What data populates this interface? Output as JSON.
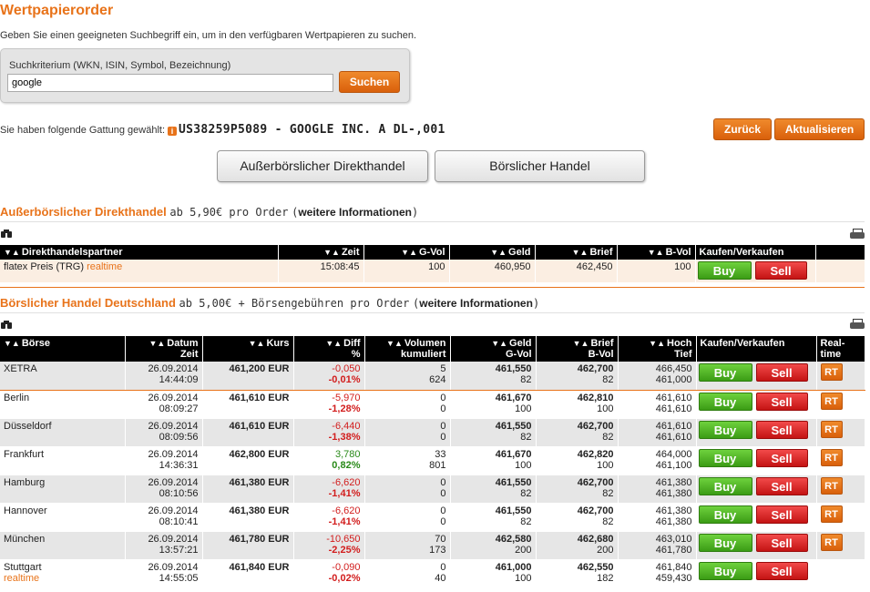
{
  "header": {
    "title": "Wertpapierorder",
    "intro": "Geben Sie einen geeigneten Suchbegriff ein, um in den verfügbaren Wertpapieren zu suchen."
  },
  "search": {
    "label": "Suchkriterium (WKN, ISIN, Symbol, Bezeichnung)",
    "value": "google",
    "button": "Suchen"
  },
  "selection": {
    "prefix": "Sie haben folgende Gattung gewählt:",
    "security": "US38259P5089 - GOOGLE INC. A DL-,001",
    "back": "Zurück",
    "refresh": "Aktualisieren"
  },
  "tabs": [
    "Außerbörslicher Direkthandel",
    "Börslicher Handel"
  ],
  "direct": {
    "heading": "Außerbörslicher Direkthandel",
    "fee": "ab 5,90€ pro Order",
    "link": "weitere Informationen",
    "columns": [
      "Direkthandelspartner",
      "Zeit",
      "G-Vol",
      "Geld",
      "Brief",
      "B-Vol",
      "Kaufen/Verkaufen"
    ],
    "row": {
      "partner": "flatex Preis (TRG)",
      "realtime": "realtime",
      "time": "15:08:45",
      "gvol": "100",
      "geld": "460,950",
      "brief": "462,450",
      "bvol": "100"
    }
  },
  "exchange": {
    "heading": "Börslicher Handel Deutschland",
    "fee": "ab 5,00€ + Börsengebühren pro Order",
    "link": "weitere Informationen",
    "columns": {
      "boerse": "Börse",
      "datum": "Datum",
      "zeit": "Zeit",
      "kurs": "Kurs",
      "diff": "Diff",
      "pct": "%",
      "volumen": "Volumen",
      "kumuliert": "kumuliert",
      "geld": "Geld",
      "gvol": "G-Vol",
      "brief": "Brief",
      "bvol": "B-Vol",
      "hoch": "Hoch",
      "tief": "Tief",
      "trade": "Kaufen/Verkaufen",
      "realtime1": "Real-",
      "realtime2": "time"
    },
    "rows": [
      {
        "name": "XETRA",
        "date": "26.09.2014",
        "time": "14:44:09",
        "kurs": "461,200 EUR",
        "diff": "-0,050",
        "pct": "-0,01%",
        "vol": "5",
        "volk": "624",
        "geld": "461,550",
        "gvol": "82",
        "brief": "462,700",
        "bvol": "82",
        "hoch": "466,450",
        "tief": "461,000",
        "rt": "RT"
      },
      {
        "name": "Berlin",
        "date": "26.09.2014",
        "time": "08:09:27",
        "kurs": "461,610 EUR",
        "diff": "-5,970",
        "pct": "-1,28%",
        "vol": "0",
        "volk": "0",
        "geld": "461,670",
        "gvol": "100",
        "brief": "462,810",
        "bvol": "100",
        "hoch": "461,610",
        "tief": "461,610",
        "rt": "RT"
      },
      {
        "name": "Düsseldorf",
        "date": "26.09.2014",
        "time": "08:09:56",
        "kurs": "461,610 EUR",
        "diff": "-6,440",
        "pct": "-1,38%",
        "vol": "0",
        "volk": "0",
        "geld": "461,550",
        "gvol": "82",
        "brief": "462,700",
        "bvol": "82",
        "hoch": "461,610",
        "tief": "461,610",
        "rt": "RT"
      },
      {
        "name": "Frankfurt",
        "date": "26.09.2014",
        "time": "14:36:31",
        "kurs": "462,800 EUR",
        "diff": "3,780",
        "pct": "0,82%",
        "vol": "33",
        "volk": "801",
        "geld": "461,670",
        "gvol": "100",
        "brief": "462,820",
        "bvol": "100",
        "hoch": "464,000",
        "tief": "461,100",
        "rt": "RT"
      },
      {
        "name": "Hamburg",
        "date": "26.09.2014",
        "time": "08:10:56",
        "kurs": "461,380 EUR",
        "diff": "-6,620",
        "pct": "-1,41%",
        "vol": "0",
        "volk": "0",
        "geld": "461,550",
        "gvol": "82",
        "brief": "462,700",
        "bvol": "82",
        "hoch": "461,380",
        "tief": "461,380",
        "rt": "RT"
      },
      {
        "name": "Hannover",
        "date": "26.09.2014",
        "time": "08:10:41",
        "kurs": "461,380 EUR",
        "diff": "-6,620",
        "pct": "-1,41%",
        "vol": "0",
        "volk": "0",
        "geld": "461,550",
        "gvol": "82",
        "brief": "462,700",
        "bvol": "82",
        "hoch": "461,380",
        "tief": "461,380",
        "rt": "RT"
      },
      {
        "name": "München",
        "date": "26.09.2014",
        "time": "13:57:21",
        "kurs": "461,780 EUR",
        "diff": "-10,650",
        "pct": "-2,25%",
        "vol": "70",
        "volk": "173",
        "geld": "462,580",
        "gvol": "200",
        "brief": "462,680",
        "bvol": "200",
        "hoch": "463,010",
        "tief": "461,780",
        "rt": "RT"
      },
      {
        "name": "Stuttgart",
        "sub": "realtime",
        "date": "26.09.2014",
        "time": "14:55:05",
        "kurs": "461,840 EUR",
        "diff": "-0,090",
        "pct": "-0,02%",
        "vol": "0",
        "volk": "40",
        "geld": "461,000",
        "gvol": "100",
        "brief": "462,550",
        "bvol": "182",
        "hoch": "461,840",
        "tief": "459,430",
        "rt": ""
      }
    ]
  },
  "buttons": {
    "buy": "Buy",
    "sell": "Sell"
  },
  "icons": {
    "binoculars": "binoculars-icon",
    "printer": "printer-icon",
    "info": "info-icon"
  },
  "colors": {
    "accent": "#e8731a",
    "buy": "#4caf25",
    "sell": "#d81b1b",
    "negative": "#d21d1d",
    "positive": "#2a8a1a"
  }
}
